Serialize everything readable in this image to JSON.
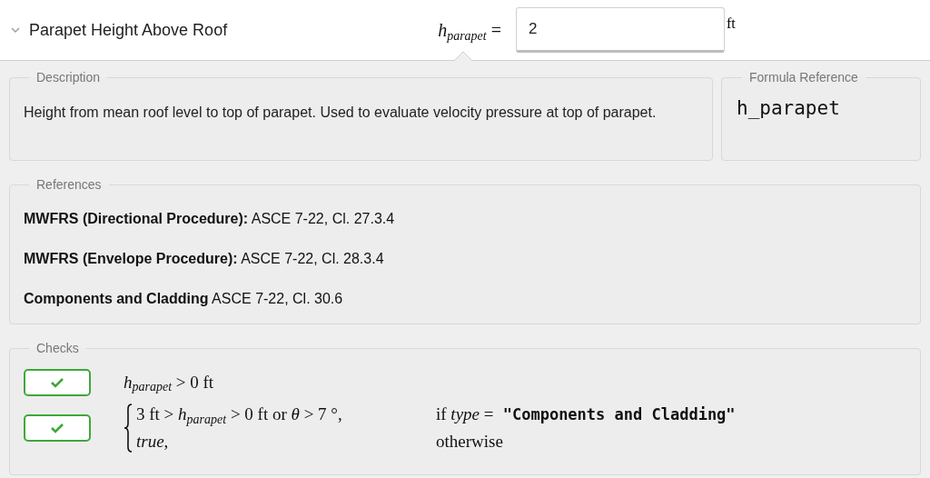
{
  "header": {
    "expanded": true,
    "title": "Parapet Height Above Roof",
    "symbol": "*h*$_{parapet}$ =",
    "value": "2",
    "unit": "ft"
  },
  "description": {
    "legend": "Description",
    "text": "Height from mean roof level to top of parapet. Used to evaluate velocity pressure at top of parapet."
  },
  "formula_reference": {
    "legend": "Formula Reference",
    "text": "h_parapet"
  },
  "references": {
    "legend": "References",
    "items": [
      {
        "label": "MWFRS (Directional Procedure):",
        "text": "ASCE 7-22, Cl. 27.3.4"
      },
      {
        "label": "MWFRS (Envelope Procedure):",
        "text": "ASCE 7-22, Cl. 28.3.4"
      },
      {
        "label": "Components and Cladding",
        "text": "ASCE 7-22, Cl. 30.6"
      }
    ]
  },
  "checks": {
    "legend": "Checks",
    "items": [
      {
        "kind": "simple",
        "passed": true,
        "expression": "*h*$_{parapet}$ > 0 ft"
      },
      {
        "kind": "piecewise",
        "passed": true,
        "cases": [
          {
            "expression": "3 ft > *h*$_{parapet}$ > 0 ft or *θ* > 7 °,",
            "condition_prefix": "if *type* =",
            "condition_string": "\"Components and Cladding\""
          },
          {
            "expression": "*true*,",
            "condition_prefix": "otherwise"
          }
        ]
      }
    ]
  }
}
